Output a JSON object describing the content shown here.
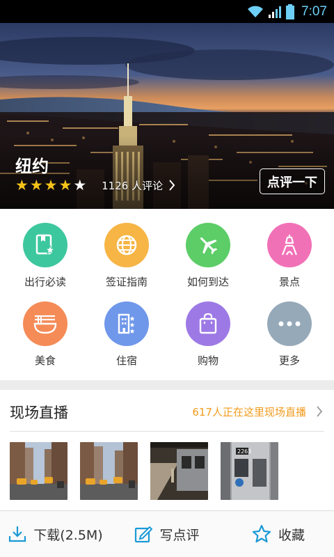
{
  "status_bar": {
    "time": "7:07",
    "icons": [
      "wifi-icon",
      "cellular-signal-icon",
      "battery-icon"
    ],
    "time_color": "#6ecff6"
  },
  "hero": {
    "city": "纽约",
    "rating": 4,
    "rating_max": 5,
    "review_count_text": "1126 人评论",
    "review_button": "点评一下",
    "star_color": "#f5c31a"
  },
  "categories": [
    {
      "label": "出行必读",
      "icon": "book-star-icon",
      "color": "#3dc79e"
    },
    {
      "label": "签证指南",
      "icon": "globe-icon",
      "color": "#f6b545"
    },
    {
      "label": "如何到达",
      "icon": "airplane-icon",
      "color": "#5ccd67"
    },
    {
      "label": "景点",
      "icon": "eiffel-tower-icon",
      "color": "#f171b7"
    },
    {
      "label": "美食",
      "icon": "noodle-bowl-icon",
      "color": "#f58b57"
    },
    {
      "label": "住宿",
      "icon": "hotel-icon",
      "color": "#6f97ea"
    },
    {
      "label": "购物",
      "icon": "shopping-bag-icon",
      "color": "#9d79e5"
    },
    {
      "label": "更多",
      "icon": "more-icon",
      "color": "#96a9b9"
    }
  ],
  "live": {
    "title": "现场直播",
    "count_text": "617人正在这里现场直播",
    "count_color": "#f29b1d",
    "thumbnails": [
      "street-photo-1",
      "street-photo-2",
      "subway-photo-1",
      "subway-photo-2"
    ]
  },
  "bottom_bar": {
    "download_label": "下载(2.5M)",
    "review_label": "写点评",
    "favorite_label": "收藏",
    "accent": "#1a9ad6"
  }
}
